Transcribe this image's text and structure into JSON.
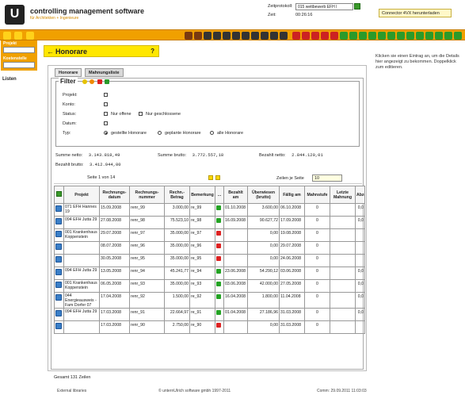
{
  "app": {
    "name": "controlling management software",
    "subtitle": "für Architekten + Ingenieure",
    "logo_letter": "U"
  },
  "header": {
    "zeitprotokoll_label": "Zeitprotokoll:",
    "zeitprotokoll_value": "015 wettbewerb EFH I",
    "zeit_label": "Zeit:",
    "zeit_value": "00:26:16",
    "connector_label": "Connector 4VX herunterladen"
  },
  "left_panel": {
    "projekt_label": "Projekt",
    "kostenstelle_label": "Kostenstelle",
    "listen_label": "Listen"
  },
  "page": {
    "title": "Honorare",
    "help": "?",
    "tabs": [
      "Honorare",
      "Mahnungsliste"
    ]
  },
  "info_text": "Klicken sie einen Eintrag an, um die Details hier angezeigt zu bekommen. Doppelklick zum editieren.",
  "filter": {
    "title": "Filter",
    "labels": {
      "projekt": "Projekt:",
      "konto": "Konto:",
      "status": "Status:",
      "datum": "Datum:",
      "typ": "Typ:"
    },
    "status_options": [
      "Nur offene",
      "Nur geschlossene"
    ],
    "typ_options": [
      "gestellte Honorare",
      "geplante Honorare",
      "alle Honorare"
    ],
    "typ_selected": "gestellte Honorare"
  },
  "summary": {
    "summe_netto_label": "Summe netto:",
    "summe_netto": "3.143.818,49",
    "summe_brutto_label": "Summe brutto:",
    "summe_brutto": "3.772.557,18",
    "bezahlt_netto_label": "Bezahlt netto:",
    "bezahlt_netto": "2.844.120,01",
    "bezahlt_brutto_label": "Bezahlt brutto:",
    "bezahlt_brutto": "3.412.944,00"
  },
  "paging": {
    "page_text": "Seite 1 von 14",
    "per_page_label": "Zeilen je Seite",
    "per_page_value": "10"
  },
  "table": {
    "headers": [
      "Projekt",
      "Rechnungs-datum",
      "Rechnungs-nummer",
      "Rechn.-Betrag",
      "Bemerkung",
      "...",
      "Bezahlt am",
      "Überwiesen (brutto)",
      "Fällig am",
      "Mahnstufe",
      "Letzte Mahnung",
      "Abze"
    ],
    "rows": [
      {
        "projekt": "071 EFH Hannes 19",
        "datum": "15.09.2008",
        "nummer": "renr_99",
        "betrag": "3.000,00",
        "bem": "re_99",
        "status": "g",
        "bezahlt": "01.10.2008",
        "ueberwiesen": "3.600,00",
        "faellig": "06.10.2008",
        "mahn": "0",
        "letzte": "",
        "abze": "0,0"
      },
      {
        "projekt": "094 EFH Jutta 29",
        "datum": "27.08.2008",
        "nummer": "renr_98",
        "betrag": "75.523,10",
        "bem": "re_98",
        "status": "g",
        "bezahlt": "16.09.2008",
        "ueberwiesen": "90.627,72",
        "faellig": "17.09.2008",
        "mahn": "0",
        "letzte": "",
        "abze": "0,0"
      },
      {
        "projekt": "001 Krankenhaus Koppenstein",
        "datum": "29.07.2008",
        "nummer": "renr_97",
        "betrag": "35.000,00",
        "bem": "re_97",
        "status": "r",
        "bezahlt": "",
        "ueberwiesen": "0,00",
        "faellig": "19.08.2008",
        "mahn": "0",
        "letzte": "",
        "abze": ""
      },
      {
        "projekt": "",
        "datum": "08.07.2008",
        "nummer": "renr_96",
        "betrag": "35.000,00",
        "bem": "re_96",
        "status": "r",
        "bezahlt": "",
        "ueberwiesen": "0,00",
        "faellig": "29.07.2008",
        "mahn": "0",
        "letzte": "",
        "abze": ""
      },
      {
        "projekt": "",
        "datum": "30.05.2008",
        "nummer": "renr_95",
        "betrag": "35.000,00",
        "bem": "re_95",
        "status": "r",
        "bezahlt": "",
        "ueberwiesen": "0,00",
        "faellig": "24.06.2008",
        "mahn": "0",
        "letzte": "",
        "abze": ""
      },
      {
        "projekt": "094 EFH Jutta 29",
        "datum": "13.05.2008",
        "nummer": "renr_94",
        "betrag": "45.241,77",
        "bem": "re_94",
        "status": "g",
        "bezahlt": "23.06.2008",
        "ueberwiesen": "54.290,12",
        "faellig": "03.06.2008",
        "mahn": "0",
        "letzte": "",
        "abze": "0,0"
      },
      {
        "projekt": "001 Krankenhaus Koppenstein",
        "datum": "06.05.2008",
        "nummer": "renr_93",
        "betrag": "35.000,00",
        "bem": "re_93",
        "status": "g",
        "bezahlt": "03.06.2008",
        "ueberwiesen": "42.000,00",
        "faellig": "27.05.2008",
        "mahn": "0",
        "letzte": "",
        "abze": "0,0"
      },
      {
        "projekt": "044 Energieausweis - Fam Dorfer 07",
        "datum": "17.04.2008",
        "nummer": "renr_92",
        "betrag": "1.500,00",
        "bem": "re_92",
        "status": "g",
        "bezahlt": "16.04.2008",
        "ueberwiesen": "1.800,00",
        "faellig": "11.04.2008",
        "mahn": "0",
        "letzte": "",
        "abze": "0,0"
      },
      {
        "projekt": "094 EFH Jutta 29",
        "datum": "17.03.2008",
        "nummer": "renr_91",
        "betrag": "22.664,97",
        "bem": "re_91",
        "status": "g",
        "bezahlt": "01.04.2008",
        "ueberwiesen": "27.186,96",
        "faellig": "31.03.2008",
        "mahn": "0",
        "letzte": "",
        "abze": "0,0"
      },
      {
        "projekt": "",
        "datum": "17.03.2008",
        "nummer": "renr_90",
        "betrag": "2.750,00",
        "bem": "re_90",
        "status": "r",
        "bezahlt": "",
        "ueberwiesen": "0,00",
        "faellig": "31.03.2008",
        "mahn": "0",
        "letzte": "",
        "abze": ""
      }
    ]
  },
  "total_rows": "Gesamt 131 Zeilen",
  "footer": {
    "left": "External libraries",
    "center": "© unternUlrich software gmbh 1997-2011",
    "right": "Comm: 29.09.2011 11:03:03"
  },
  "colors": {
    "accent": "#f0a000",
    "title_bar": "#ffe700",
    "ok": "#24a324",
    "open": "#dd2222"
  }
}
